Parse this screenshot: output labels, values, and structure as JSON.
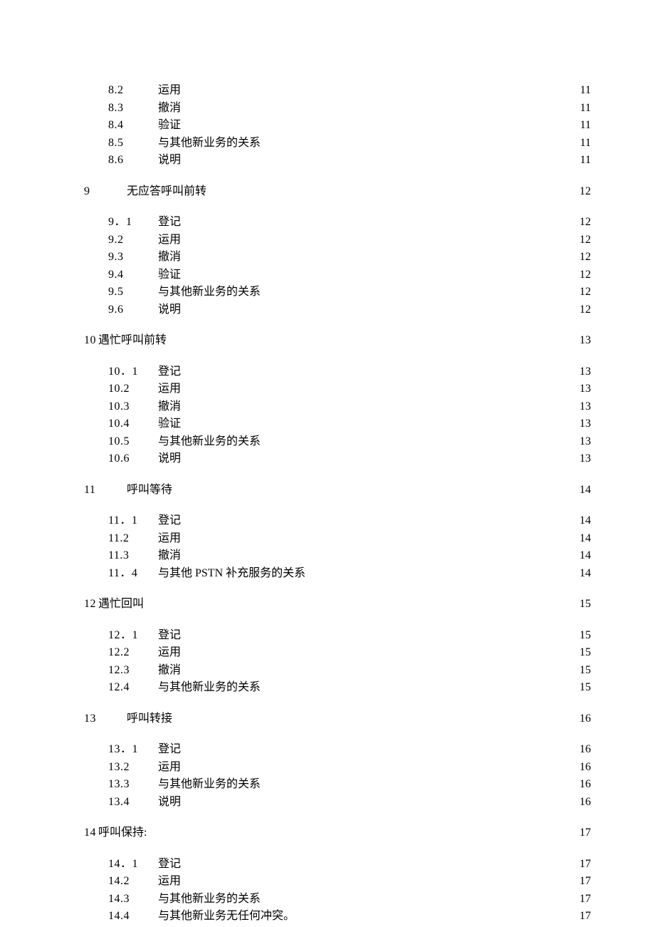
{
  "toc": [
    {
      "level": 2,
      "num": "8.2",
      "title": "运用",
      "page": "11"
    },
    {
      "level": 2,
      "num": "8.3",
      "title": "撤消",
      "page": "11"
    },
    {
      "level": 2,
      "num": "8.4",
      "title": "验证",
      "page": "11"
    },
    {
      "level": 2,
      "num": "8.5",
      "title": "与其他新业务的关系",
      "page": "11"
    },
    {
      "level": 2,
      "num": "8.6",
      "title": "说明",
      "page": "11"
    },
    {
      "level": 1,
      "num": "9",
      "title": "无应答呼叫前转",
      "page": "12"
    },
    {
      "level": 2,
      "num": "9．1",
      "title": "登记",
      "page": "12"
    },
    {
      "level": 2,
      "num": "9.2",
      "title": "运用",
      "page": "12"
    },
    {
      "level": 2,
      "num": "9.3",
      "title": "撤消",
      "page": "12"
    },
    {
      "level": 2,
      "num": "9.4",
      "title": "验证",
      "page": "12"
    },
    {
      "level": 2,
      "num": "9.5",
      "title": "与其他新业务的关系",
      "page": "12"
    },
    {
      "level": 2,
      "num": "9.6",
      "title": "说明",
      "page": "12"
    },
    {
      "level": 1,
      "num": "10",
      "title": "遇忙呼叫前转",
      "page": "13",
      "numPad": "20px"
    },
    {
      "level": 2,
      "num": "10．1",
      "title": "登记",
      "page": "13"
    },
    {
      "level": 2,
      "num": "10.2",
      "title": "运用",
      "page": "13"
    },
    {
      "level": 2,
      "num": "10.3",
      "title": "撤消",
      "page": "13"
    },
    {
      "level": 2,
      "num": "10.4",
      "title": "验证",
      "page": "13"
    },
    {
      "level": 2,
      "num": "10.5",
      "title": "与其他新业务的关系",
      "page": "13"
    },
    {
      "level": 2,
      "num": "10.6",
      "title": "说明",
      "page": "13"
    },
    {
      "level": 1,
      "num": "11",
      "title": "呼叫等待",
      "page": "14"
    },
    {
      "level": 2,
      "num": "11．1",
      "title": "登记",
      "page": "14"
    },
    {
      "level": 2,
      "num": "11.2",
      "title": "运用",
      "page": "14"
    },
    {
      "level": 2,
      "num": "11.3",
      "title": "撤消",
      "page": "14"
    },
    {
      "level": 2,
      "num": "11．4",
      "title": "与其他 PSTN 补充服务的关系",
      "page": "14"
    },
    {
      "level": 1,
      "num": "12",
      "title": "遇忙回叫",
      "page": "15",
      "numPad": "20px"
    },
    {
      "level": 2,
      "num": "12．1",
      "title": "登记",
      "page": "15"
    },
    {
      "level": 2,
      "num": "12.2",
      "title": "运用",
      "page": "15"
    },
    {
      "level": 2,
      "num": "12.3",
      "title": "撤消",
      "page": "15"
    },
    {
      "level": 2,
      "num": "12.4",
      "title": "与其他新业务的关系",
      "page": "15"
    },
    {
      "level": 1,
      "num": "13",
      "title": "呼叫转接",
      "page": "16"
    },
    {
      "level": 2,
      "num": "13．1",
      "title": "登记",
      "page": "16"
    },
    {
      "level": 2,
      "num": "13.2",
      "title": "运用",
      "page": "16"
    },
    {
      "level": 2,
      "num": "13.3",
      "title": "与其他新业务的关系",
      "page": "16"
    },
    {
      "level": 2,
      "num": "13.4",
      "title": "说明",
      "page": "16"
    },
    {
      "level": 1,
      "num": "14",
      "title": "呼叫保持:",
      "page": "17",
      "numPad": "20px"
    },
    {
      "level": 2,
      "num": "14．1",
      "title": "登记",
      "page": "17"
    },
    {
      "level": 2,
      "num": "14.2",
      "title": "运用",
      "page": "17"
    },
    {
      "level": 2,
      "num": "14.3",
      "title": "与其他新业务的关系",
      "page": "17"
    },
    {
      "level": 2,
      "num": "14.4",
      "title": "与其他新业务无任何冲突。",
      "page": "17"
    }
  ]
}
